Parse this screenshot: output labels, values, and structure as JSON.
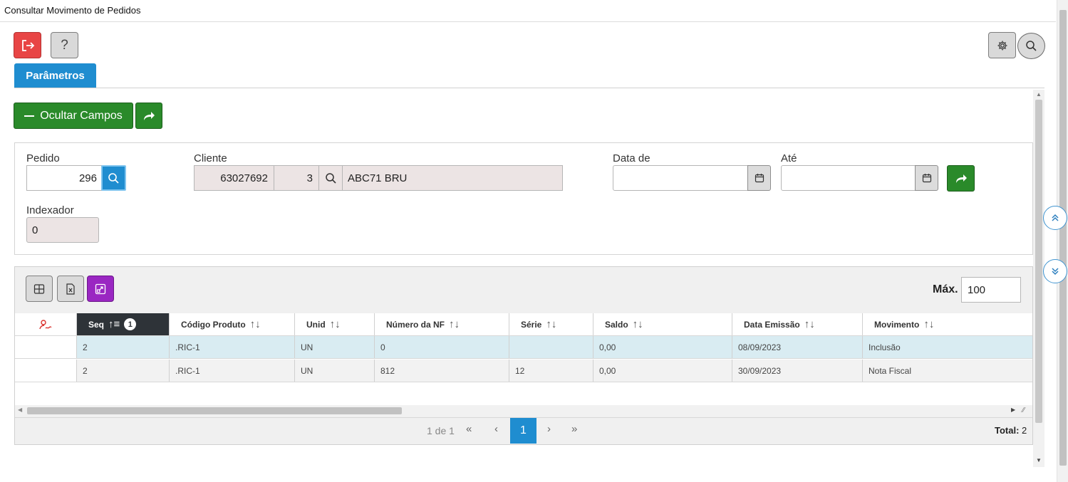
{
  "window": {
    "title": "Consultar Movimento de Pedidos"
  },
  "icons": {
    "exit": "exit-icon",
    "help": "help-icon",
    "settings": "gear-icon",
    "search": "search-icon",
    "share": "share-arrow-icon",
    "calendar": "calendar-icon",
    "grid": "grid-icon",
    "excel": "excel-icon",
    "expand": "expand-icon",
    "filter_clear": "filter-clear-icon",
    "scroll_up": "double-chevron-up-icon",
    "scroll_down": "double-chevron-down-icon"
  },
  "toolbar": {
    "help_label": "?"
  },
  "tabs": {
    "parametros": "Parâmetros"
  },
  "actions": {
    "ocultar_label": "Ocultar Campos"
  },
  "form": {
    "pedido": {
      "label": "Pedido",
      "value": "296"
    },
    "cliente": {
      "label": "Cliente",
      "code": "63027692",
      "seq": "3",
      "name": "ABC71 BRU"
    },
    "data_de": {
      "label": "Data de",
      "value": ""
    },
    "ate": {
      "label": "Até",
      "value": ""
    },
    "indexador": {
      "label": "Indexador",
      "value": "0"
    }
  },
  "grid": {
    "max_label": "Máx.",
    "max_value": "100",
    "sort_badge": "1",
    "columns": [
      "Seq",
      "Código Produto",
      "Unid",
      "Número da NF",
      "Série",
      "Saldo",
      "Data Emissão",
      "Movimento"
    ],
    "rows": [
      [
        "2",
        ".RIC-1",
        "UN",
        "0",
        "",
        "0,00",
        "08/09/2023",
        "Inclusão"
      ],
      [
        "2",
        ".RIC-1",
        "UN",
        "812",
        "12",
        "0,00",
        "30/09/2023",
        "Nota Fiscal"
      ]
    ],
    "selected_row": 0
  },
  "pager": {
    "info": "1 de 1",
    "first": "«",
    "prev": "‹",
    "current": "1",
    "next": "›",
    "last": "»",
    "total_label": "Total:",
    "total_value": "2"
  },
  "colors": {
    "primary": "#1f8dd0",
    "green": "#2a8a2a",
    "danger": "#e84545",
    "purple": "#9a27c2",
    "header_dark": "#2e3338",
    "row_selected": "#d9ecf2"
  }
}
